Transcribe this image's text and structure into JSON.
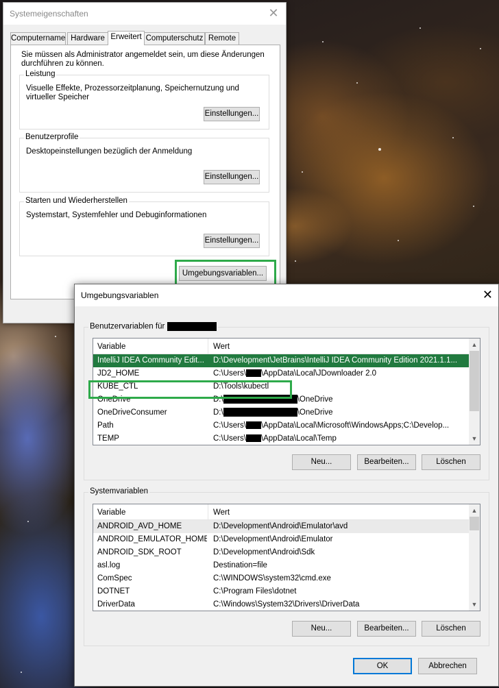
{
  "system_properties": {
    "title": "Systemeigenschaften",
    "tabs": [
      {
        "label": "Computername"
      },
      {
        "label": "Hardware"
      },
      {
        "label": "Erweitert"
      },
      {
        "label": "Computerschutz"
      },
      {
        "label": "Remote"
      }
    ],
    "intro": "Sie müssen als Administrator angemeldet sein, um diese Änderungen durchführen zu können.",
    "groups": [
      {
        "title": "Leistung",
        "description": "Visuelle Effekte, Prozessorzeitplanung, Speichernutzung und virtueller Speicher",
        "button": "Einstellungen..."
      },
      {
        "title": "Benutzerprofile",
        "description": "Desktopeinstellungen bezüglich der Anmeldung",
        "button": "Einstellungen..."
      },
      {
        "title": "Starten und Wiederherstellen",
        "description": "Systemstart, Systemfehler und Debuginformationen",
        "button": "Einstellungen..."
      }
    ],
    "env_button": "Umgebungsvariablen..."
  },
  "env_dialog": {
    "title": "Umgebungsvariablen",
    "user_section_label": "Benutzervariablen für",
    "columns": {
      "variable": "Variable",
      "value": "Wert"
    },
    "user_vars": [
      {
        "name": "IntelliJ IDEA Community Edit...",
        "value": "D:\\Development\\JetBrains\\IntelliJ IDEA Community Edition 2021.1.1..."
      },
      {
        "name": "JD2_HOME",
        "value_pre": "C:\\Users\\",
        "value_post": "\\AppData\\Local\\JDownloader 2.0"
      },
      {
        "name": "KUBE_CTL",
        "value": "D:\\Tools\\kubectl"
      },
      {
        "name": "OneDrive",
        "value_pre": "D:\\",
        "value_post": "\\OneDrive"
      },
      {
        "name": "OneDriveConsumer",
        "value_pre": "D:\\",
        "value_post": "\\OneDrive"
      },
      {
        "name": "Path",
        "value_pre": "C:\\Users\\",
        "value_post": "\\AppData\\Local\\Microsoft\\WindowsApps;C:\\Develop..."
      },
      {
        "name": "TEMP",
        "value_pre": "C:\\Users\\",
        "value_post": "\\AppData\\Local\\Temp"
      }
    ],
    "user_buttons": {
      "new": "Neu...",
      "edit": "Bearbeiten...",
      "delete": "Löschen"
    },
    "system_section_label": "Systemvariablen",
    "system_vars": [
      {
        "name": "ANDROID_AVD_HOME",
        "value": "D:\\Development\\Android\\Emulator\\avd"
      },
      {
        "name": "ANDROID_EMULATOR_HOME",
        "value": "D:\\Development\\Android\\Emulator"
      },
      {
        "name": "ANDROID_SDK_ROOT",
        "value": "D:\\Development\\Android\\Sdk"
      },
      {
        "name": "asl.log",
        "value": "Destination=file"
      },
      {
        "name": "ComSpec",
        "value": "C:\\WINDOWS\\system32\\cmd.exe"
      },
      {
        "name": "DOTNET",
        "value": "C:\\Program Files\\dotnet"
      },
      {
        "name": "DriverData",
        "value": "C:\\Windows\\System32\\Drivers\\DriverData"
      }
    ],
    "system_buttons": {
      "new": "Neu...",
      "edit": "Bearbeiten...",
      "delete": "Löschen"
    },
    "ok": "OK",
    "cancel": "Abbrechen"
  },
  "colors": {
    "highlight_green": "#2eaa4a",
    "selected_row": "#217a3f",
    "focus_blue": "#0078d7"
  },
  "icons": {
    "close": "close-icon",
    "scroll_up": "chevron-up-icon",
    "scroll_down": "chevron-down-icon"
  }
}
